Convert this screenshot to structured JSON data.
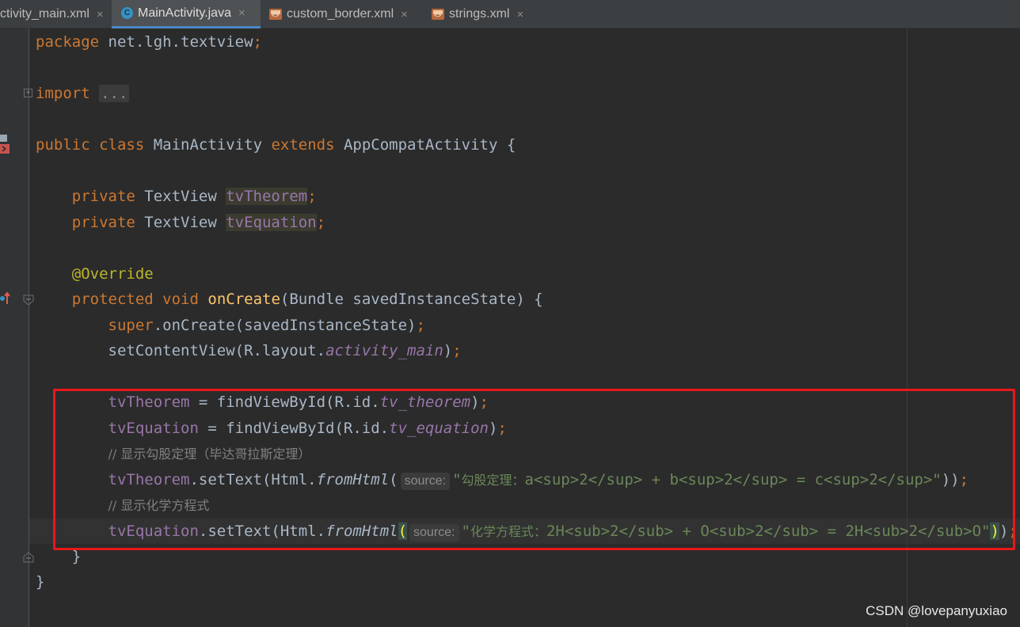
{
  "tabs": [
    {
      "label": "ctivity_main.xml",
      "icon": "xml-file-icon",
      "active": false
    },
    {
      "label": "MainActivity.java",
      "icon": "java-class-icon",
      "active": true
    },
    {
      "label": "custom_border.xml",
      "icon": "xml-file-icon",
      "active": false
    },
    {
      "label": "strings.xml",
      "icon": "xml-file-icon",
      "active": false
    }
  ],
  "tab_close_glyph": "×",
  "java_icon_letter": "C",
  "xml_icon_text": "<>",
  "code": {
    "l1": {
      "kw": "package",
      "rest": " net.lgh.textview",
      "semi": ";"
    },
    "l2": {
      "kw": "import",
      "dots": "..."
    },
    "l3": {
      "kw1": "public",
      "kw2": "class",
      "name": " MainActivity ",
      "kw3": "extends",
      "rest": " AppCompatActivity {"
    },
    "l4": {
      "kw": "private",
      "type": " TextView ",
      "field": "tvTheorem",
      "semi": ";"
    },
    "l5": {
      "kw": "private",
      "type": " TextView ",
      "field": "tvEquation",
      "semi": ";"
    },
    "l6": {
      "ann": "@Override"
    },
    "l7": {
      "kw1": "protected",
      "kw2": "void",
      "fn": "onCreate",
      "rest": "(Bundle savedInstanceState) {"
    },
    "l8": {
      "kw": "super",
      "rest": ".onCreate(savedInstanceState)",
      "semi": ";"
    },
    "l9": {
      "pre": "setContentView(R.layout.",
      "st": "activity_main",
      "post": ")",
      "semi": ";"
    },
    "l10": {
      "field": "tvTheorem",
      "pre": " = findViewById(R.id.",
      "st": "tv_theorem",
      "post": ")",
      "semi": ";"
    },
    "l11": {
      "field": "tvEquation",
      "pre": " = findViewById(R.id.",
      "st": "tv_equation",
      "post": ")",
      "semi": ";"
    },
    "l12": {
      "comment": "// 显示勾股定理（毕达哥拉斯定理）"
    },
    "l13": {
      "field": "tvTheorem",
      "pre": ".setText(Html.",
      "method": "fromHtml",
      "open": "(",
      "hint": "source:",
      "str_q1": "\"",
      "str_cjk": "勾股定理：",
      "str_rest": "a<sup>2</sup> + b<sup>2</sup> = c<sup>2</sup>\"",
      "post": "))",
      "semi": ";"
    },
    "l14": {
      "comment": "// 显示化学方程式"
    },
    "l15": {
      "field": "tvEquation",
      "pre": ".setText(Html.",
      "method": "fromHtml",
      "open": "(",
      "hint": "source:",
      "str_q1": "\"",
      "str_cjk": "化学方程式：",
      "str_rest": "2H<sub>2</sub> + O<sub>2</sub> = 2H<sub>2</sub>O\"",
      "close1": ")",
      "close2": ")",
      "semi": ";"
    },
    "l16": {
      "text": "}"
    },
    "l17": {
      "text": "}"
    }
  },
  "watermark": "CSDN @lovepanyuxiao",
  "colors": {
    "background": "#2b2b2b",
    "keyword": "#cc7832",
    "field": "#9876aa",
    "string": "#6a8759",
    "comment": "#808080",
    "method_decl": "#ffc66d",
    "annotation": "#bbb529",
    "highlight_box": "#e8181b"
  }
}
